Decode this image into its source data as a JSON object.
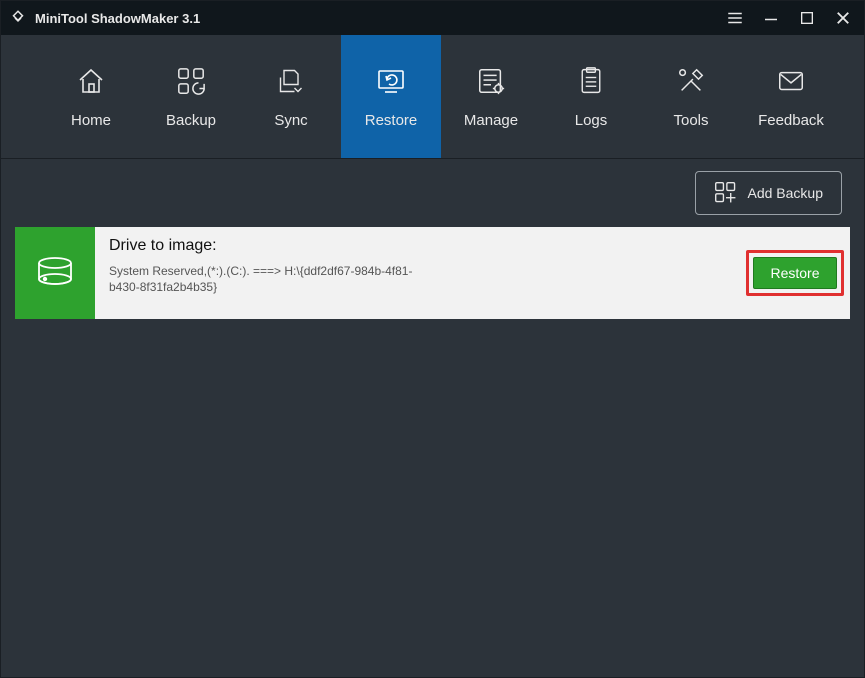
{
  "title": "MiniTool ShadowMaker 3.1",
  "nav": {
    "home": "Home",
    "backup": "Backup",
    "sync": "Sync",
    "restore": "Restore",
    "manage": "Manage",
    "logs": "Logs",
    "tools": "Tools",
    "feedback": "Feedback",
    "active": "restore"
  },
  "toolbar": {
    "add_backup": "Add Backup"
  },
  "card": {
    "heading": "Drive to image:",
    "detail": "System Reserved,(*:).(C:). ===> H:\\{ddf2df67-984b-4f81-b430-8f31fa2b4b35}",
    "restore_label": "Restore"
  }
}
